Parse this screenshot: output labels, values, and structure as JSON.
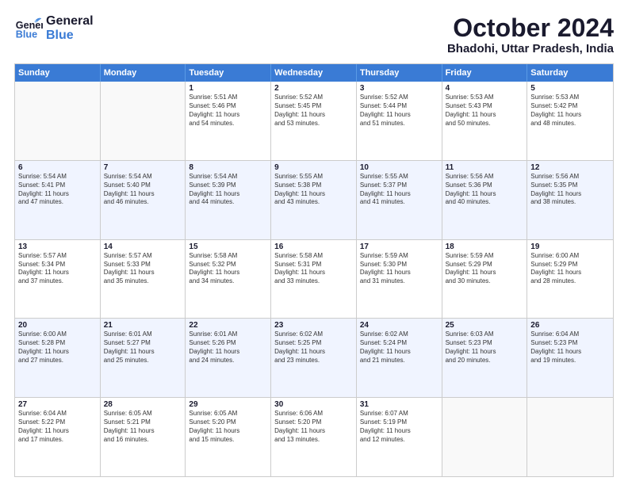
{
  "header": {
    "logo_general": "General",
    "logo_blue": "Blue",
    "title": "October 2024",
    "subtitle": "Bhadohi, Uttar Pradesh, India"
  },
  "days_of_week": [
    "Sunday",
    "Monday",
    "Tuesday",
    "Wednesday",
    "Thursday",
    "Friday",
    "Saturday"
  ],
  "rows": [
    {
      "alt": false,
      "cells": [
        {
          "num": "",
          "lines": []
        },
        {
          "num": "",
          "lines": []
        },
        {
          "num": "1",
          "lines": [
            "Sunrise: 5:51 AM",
            "Sunset: 5:46 PM",
            "Daylight: 11 hours",
            "and 54 minutes."
          ]
        },
        {
          "num": "2",
          "lines": [
            "Sunrise: 5:52 AM",
            "Sunset: 5:45 PM",
            "Daylight: 11 hours",
            "and 53 minutes."
          ]
        },
        {
          "num": "3",
          "lines": [
            "Sunrise: 5:52 AM",
            "Sunset: 5:44 PM",
            "Daylight: 11 hours",
            "and 51 minutes."
          ]
        },
        {
          "num": "4",
          "lines": [
            "Sunrise: 5:53 AM",
            "Sunset: 5:43 PM",
            "Daylight: 11 hours",
            "and 50 minutes."
          ]
        },
        {
          "num": "5",
          "lines": [
            "Sunrise: 5:53 AM",
            "Sunset: 5:42 PM",
            "Daylight: 11 hours",
            "and 48 minutes."
          ]
        }
      ]
    },
    {
      "alt": true,
      "cells": [
        {
          "num": "6",
          "lines": [
            "Sunrise: 5:54 AM",
            "Sunset: 5:41 PM",
            "Daylight: 11 hours",
            "and 47 minutes."
          ]
        },
        {
          "num": "7",
          "lines": [
            "Sunrise: 5:54 AM",
            "Sunset: 5:40 PM",
            "Daylight: 11 hours",
            "and 46 minutes."
          ]
        },
        {
          "num": "8",
          "lines": [
            "Sunrise: 5:54 AM",
            "Sunset: 5:39 PM",
            "Daylight: 11 hours",
            "and 44 minutes."
          ]
        },
        {
          "num": "9",
          "lines": [
            "Sunrise: 5:55 AM",
            "Sunset: 5:38 PM",
            "Daylight: 11 hours",
            "and 43 minutes."
          ]
        },
        {
          "num": "10",
          "lines": [
            "Sunrise: 5:55 AM",
            "Sunset: 5:37 PM",
            "Daylight: 11 hours",
            "and 41 minutes."
          ]
        },
        {
          "num": "11",
          "lines": [
            "Sunrise: 5:56 AM",
            "Sunset: 5:36 PM",
            "Daylight: 11 hours",
            "and 40 minutes."
          ]
        },
        {
          "num": "12",
          "lines": [
            "Sunrise: 5:56 AM",
            "Sunset: 5:35 PM",
            "Daylight: 11 hours",
            "and 38 minutes."
          ]
        }
      ]
    },
    {
      "alt": false,
      "cells": [
        {
          "num": "13",
          "lines": [
            "Sunrise: 5:57 AM",
            "Sunset: 5:34 PM",
            "Daylight: 11 hours",
            "and 37 minutes."
          ]
        },
        {
          "num": "14",
          "lines": [
            "Sunrise: 5:57 AM",
            "Sunset: 5:33 PM",
            "Daylight: 11 hours",
            "and 35 minutes."
          ]
        },
        {
          "num": "15",
          "lines": [
            "Sunrise: 5:58 AM",
            "Sunset: 5:32 PM",
            "Daylight: 11 hours",
            "and 34 minutes."
          ]
        },
        {
          "num": "16",
          "lines": [
            "Sunrise: 5:58 AM",
            "Sunset: 5:31 PM",
            "Daylight: 11 hours",
            "and 33 minutes."
          ]
        },
        {
          "num": "17",
          "lines": [
            "Sunrise: 5:59 AM",
            "Sunset: 5:30 PM",
            "Daylight: 11 hours",
            "and 31 minutes."
          ]
        },
        {
          "num": "18",
          "lines": [
            "Sunrise: 5:59 AM",
            "Sunset: 5:29 PM",
            "Daylight: 11 hours",
            "and 30 minutes."
          ]
        },
        {
          "num": "19",
          "lines": [
            "Sunrise: 6:00 AM",
            "Sunset: 5:29 PM",
            "Daylight: 11 hours",
            "and 28 minutes."
          ]
        }
      ]
    },
    {
      "alt": true,
      "cells": [
        {
          "num": "20",
          "lines": [
            "Sunrise: 6:00 AM",
            "Sunset: 5:28 PM",
            "Daylight: 11 hours",
            "and 27 minutes."
          ]
        },
        {
          "num": "21",
          "lines": [
            "Sunrise: 6:01 AM",
            "Sunset: 5:27 PM",
            "Daylight: 11 hours",
            "and 25 minutes."
          ]
        },
        {
          "num": "22",
          "lines": [
            "Sunrise: 6:01 AM",
            "Sunset: 5:26 PM",
            "Daylight: 11 hours",
            "and 24 minutes."
          ]
        },
        {
          "num": "23",
          "lines": [
            "Sunrise: 6:02 AM",
            "Sunset: 5:25 PM",
            "Daylight: 11 hours",
            "and 23 minutes."
          ]
        },
        {
          "num": "24",
          "lines": [
            "Sunrise: 6:02 AM",
            "Sunset: 5:24 PM",
            "Daylight: 11 hours",
            "and 21 minutes."
          ]
        },
        {
          "num": "25",
          "lines": [
            "Sunrise: 6:03 AM",
            "Sunset: 5:23 PM",
            "Daylight: 11 hours",
            "and 20 minutes."
          ]
        },
        {
          "num": "26",
          "lines": [
            "Sunrise: 6:04 AM",
            "Sunset: 5:23 PM",
            "Daylight: 11 hours",
            "and 19 minutes."
          ]
        }
      ]
    },
    {
      "alt": false,
      "cells": [
        {
          "num": "27",
          "lines": [
            "Sunrise: 6:04 AM",
            "Sunset: 5:22 PM",
            "Daylight: 11 hours",
            "and 17 minutes."
          ]
        },
        {
          "num": "28",
          "lines": [
            "Sunrise: 6:05 AM",
            "Sunset: 5:21 PM",
            "Daylight: 11 hours",
            "and 16 minutes."
          ]
        },
        {
          "num": "29",
          "lines": [
            "Sunrise: 6:05 AM",
            "Sunset: 5:20 PM",
            "Daylight: 11 hours",
            "and 15 minutes."
          ]
        },
        {
          "num": "30",
          "lines": [
            "Sunrise: 6:06 AM",
            "Sunset: 5:20 PM",
            "Daylight: 11 hours",
            "and 13 minutes."
          ]
        },
        {
          "num": "31",
          "lines": [
            "Sunrise: 6:07 AM",
            "Sunset: 5:19 PM",
            "Daylight: 11 hours",
            "and 12 minutes."
          ]
        },
        {
          "num": "",
          "lines": []
        },
        {
          "num": "",
          "lines": []
        }
      ]
    }
  ]
}
